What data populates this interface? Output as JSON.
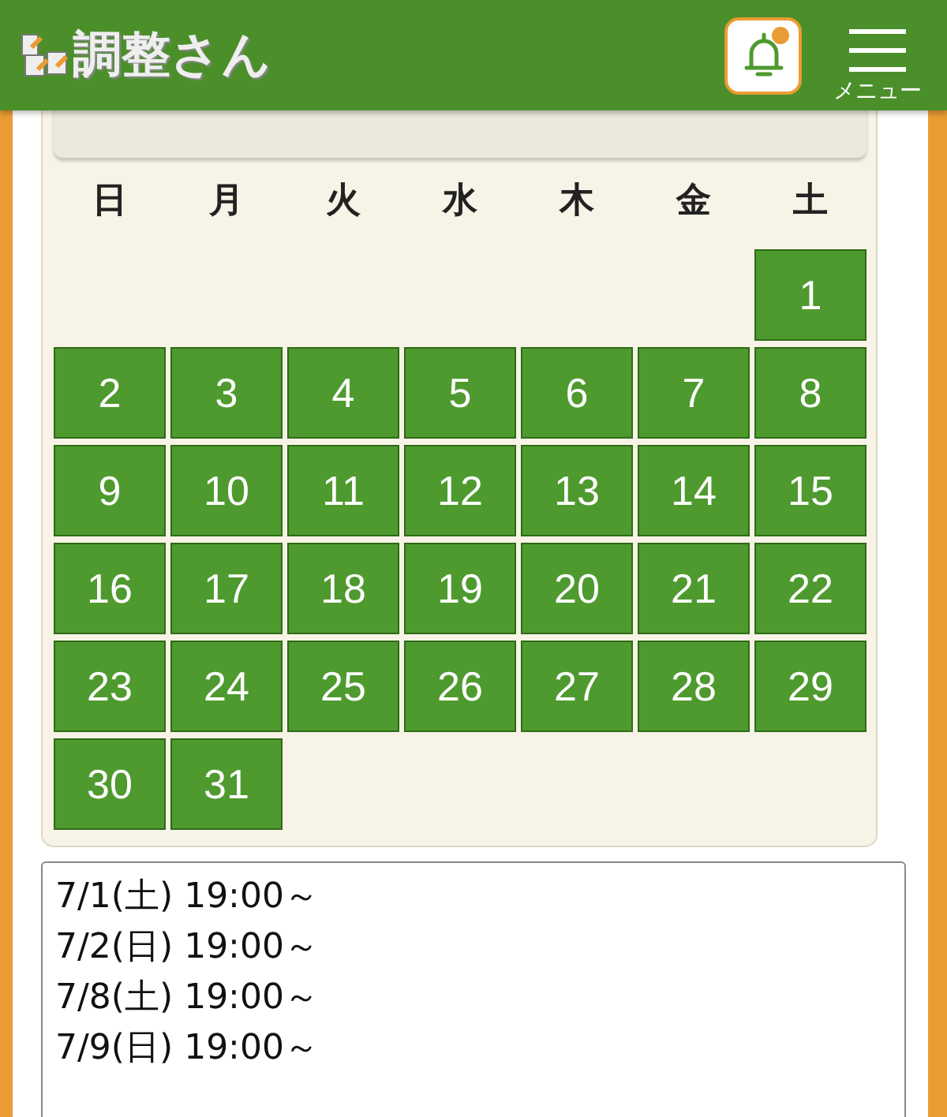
{
  "header": {
    "logo_text": "調整さん",
    "notification_badge": true,
    "menu_label": "メニュー"
  },
  "calendar": {
    "weekdays": [
      "日",
      "月",
      "火",
      "水",
      "木",
      "金",
      "土"
    ],
    "weeks": [
      [
        "1"
      ],
      [
        "2",
        "3",
        "4",
        "5",
        "6",
        "7",
        "8"
      ],
      [
        "9",
        "10",
        "11",
        "12",
        "13",
        "14",
        "15"
      ],
      [
        "16",
        "17",
        "18",
        "19",
        "20",
        "21",
        "22"
      ],
      [
        "23",
        "24",
        "25",
        "26",
        "27",
        "28",
        "29"
      ],
      [
        "30",
        "31"
      ]
    ]
  },
  "candidates": {
    "value": "7/1(土) 19:00～\n7/2(日) 19:00～\n7/8(土) 19:00～\n7/9(日) 19:00～"
  }
}
